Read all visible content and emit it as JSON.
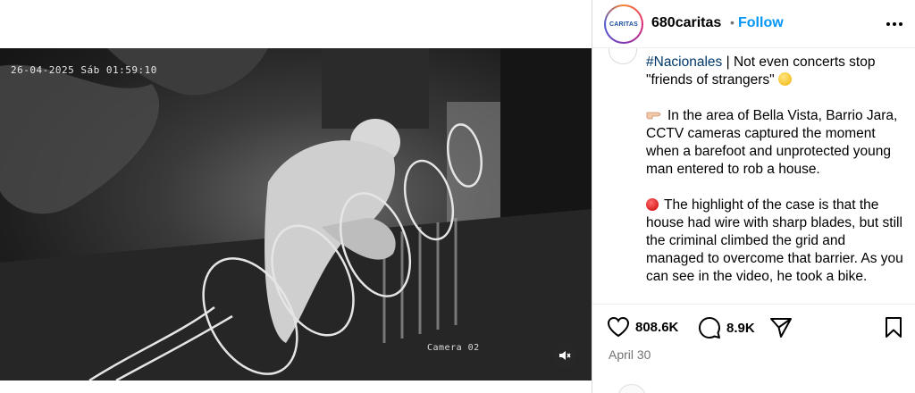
{
  "video": {
    "timestamp": "26-04-2025 Sáb 01:59:10",
    "camera_label": "Camera 02",
    "mute_icon": "speaker-muted-icon"
  },
  "header": {
    "avatar_text": "CARITAS",
    "username": "680caritas",
    "separator": "•",
    "follow_label": "Follow",
    "more_icon": "more-horizontal-icon"
  },
  "caption": {
    "hashtag": "#Nacionales",
    "line1_rest": " | Not even concerts stop \"friends of strangers\"",
    "para2": "In the area of Bella Vista, Barrio Jara, CCTV cameras captured the moment when a barefoot and unprotected young man entered to rob a house.",
    "para3": "The highlight of the case is that the house had wire with sharp blades, but still the criminal climbed the grid and managed to overcome that barrier. As you can see in the video, he took a bike."
  },
  "actions": {
    "likes": "808.6K",
    "comments": "8.9K",
    "like_icon": "heart-icon",
    "comment_icon": "comment-icon",
    "share_icon": "paper-plane-icon",
    "save_icon": "bookmark-icon"
  },
  "date": "April 30",
  "colors": {
    "follow": "#0095f6",
    "hashtag": "#00376b",
    "muted_text": "#737373"
  }
}
